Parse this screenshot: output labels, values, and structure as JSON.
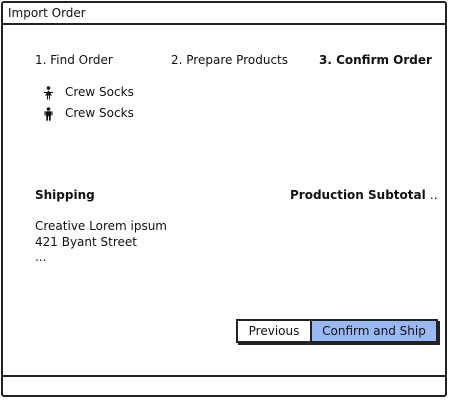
{
  "window": {
    "title": "Import Order"
  },
  "steps": [
    {
      "label": "1. Find Order"
    },
    {
      "label": "2. Prepare Products"
    },
    {
      "label": "3. Confirm Order"
    }
  ],
  "products": [
    {
      "icon": "female-person-icon",
      "label": "Crew Socks"
    },
    {
      "icon": "male-person-icon",
      "label": "Crew Socks"
    }
  ],
  "shipping": {
    "heading": "Shipping",
    "address_lines": [
      "Creative Lorem ipsum",
      "421 Byant Street",
      "..."
    ]
  },
  "production_subtotal": {
    "heading": "Production Subtotal",
    "value": ".."
  },
  "buttons": {
    "previous": "Previous",
    "confirm": "Confirm and Ship"
  },
  "colors": {
    "primary_button": "#9ab8f4",
    "border": "#222222"
  }
}
